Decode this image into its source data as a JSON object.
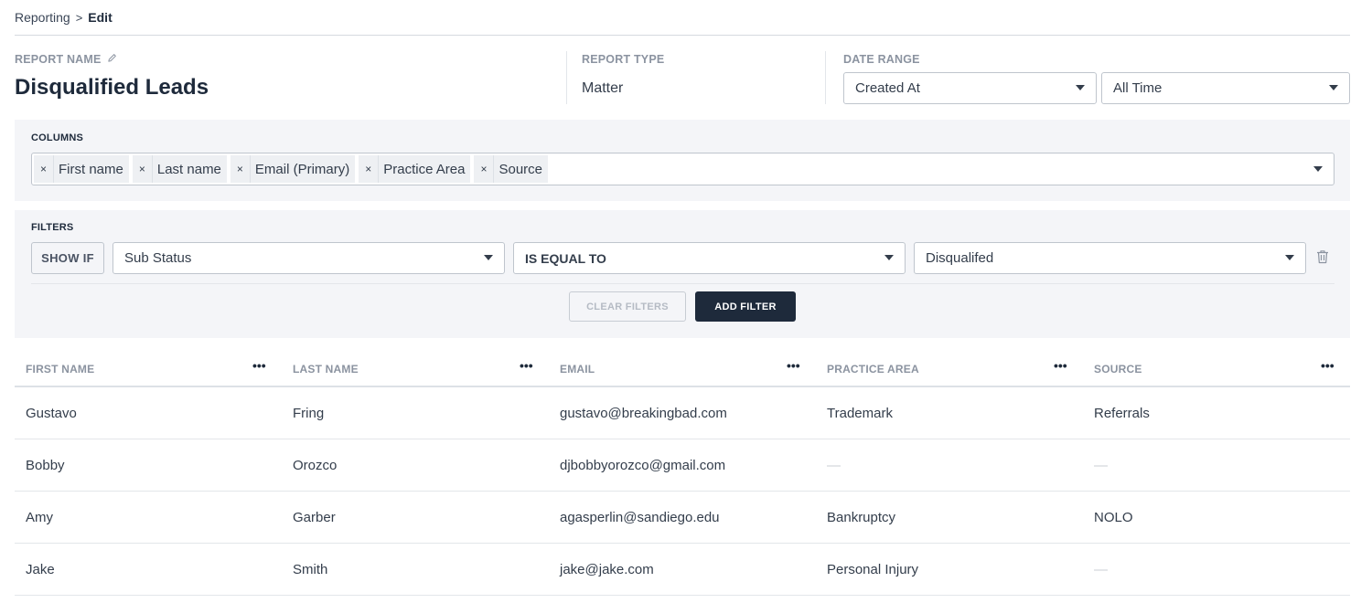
{
  "breadcrumb": {
    "parent": "Reporting",
    "separator": ">",
    "current": "Edit"
  },
  "report": {
    "name_label": "REPORT NAME",
    "name": "Disqualified Leads",
    "type_label": "REPORT TYPE",
    "type": "Matter",
    "date_range_label": "DATE RANGE",
    "date_field": "Created At",
    "date_period": "All Time"
  },
  "columns": {
    "label": "COLUMNS",
    "tags": [
      "First name",
      "Last name",
      "Email (Primary)",
      "Practice Area",
      "Source"
    ],
    "remove_glyph": "×"
  },
  "filters": {
    "label": "FILTERS",
    "show_if": "SHOW IF",
    "field": "Sub Status",
    "operator": "IS EQUAL TO",
    "value": "Disqualifed",
    "clear_label": "CLEAR FILTERS",
    "add_label": "ADD FILTER"
  },
  "table": {
    "headers": [
      "FIRST NAME",
      "LAST NAME",
      "EMAIL",
      "PRACTICE AREA",
      "SOURCE"
    ],
    "menu_glyph": "•••",
    "rows": [
      [
        "Gustavo",
        "Fring",
        "gustavo@breakingbad.com",
        "Trademark",
        "Referrals"
      ],
      [
        "Bobby",
        "Orozco",
        "djbobbyorozco@gmail.com",
        "—",
        "—"
      ],
      [
        "Amy",
        "Garber",
        "agasperlin@sandiego.edu",
        "Bankruptcy",
        "NOLO"
      ],
      [
        "Jake",
        "Smith",
        "jake@jake.com",
        "Personal Injury",
        "—"
      ]
    ]
  },
  "icons": {
    "pencil": "pencil-icon",
    "trash": "trash-icon",
    "caret": "caret-down-icon",
    "remove": "close-icon",
    "more": "more-horizontal-icon"
  },
  "colors": {
    "primary_button": "#1e2a3b",
    "panel_bg": "#f4f5f8",
    "muted_label": "#8b93a0"
  }
}
